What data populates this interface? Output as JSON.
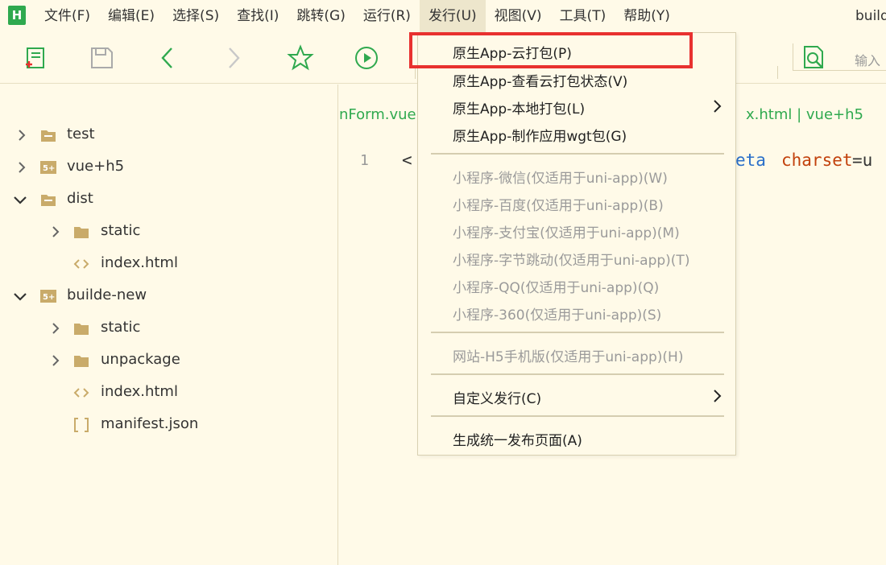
{
  "app": {
    "logo_letter": "H",
    "window_title": "builde"
  },
  "menubar": {
    "items": [
      {
        "label": "文件(F)"
      },
      {
        "label": "编辑(E)"
      },
      {
        "label": "选择(S)"
      },
      {
        "label": "查找(I)"
      },
      {
        "label": "跳转(G)"
      },
      {
        "label": "运行(R)"
      },
      {
        "label": "发行(U)"
      },
      {
        "label": "视图(V)"
      },
      {
        "label": "工具(T)"
      },
      {
        "label": "帮助(Y)"
      }
    ],
    "active_index": 6
  },
  "toolbar": {
    "search_placeholder": "输入"
  },
  "sidebar": {
    "items": [
      {
        "label": "test",
        "icon": "folder-icon"
      },
      {
        "label": "vue+h5",
        "icon": "uniapp-project-icon"
      },
      {
        "label": "dist",
        "icon": "folder-icon"
      },
      {
        "label": "static",
        "icon": "folder-icon"
      },
      {
        "label": "index.html",
        "icon": "html-file-icon"
      },
      {
        "label": "builde-new",
        "icon": "uniapp-project-icon"
      },
      {
        "label": "static",
        "icon": "folder-icon"
      },
      {
        "label": "unpackage",
        "icon": "folder-icon"
      },
      {
        "label": "index.html",
        "icon": "html-file-icon"
      },
      {
        "label": "manifest.json",
        "icon": "json-file-icon"
      }
    ]
  },
  "editor": {
    "tab_left": "nForm.vue",
    "tab_right": "x.html | vue+h5",
    "line_number": "1",
    "code_start": "<",
    "code_keyword": "eta",
    "code_attr": "charset",
    "code_rest": "=u"
  },
  "dropdown": {
    "items": [
      {
        "label": "原生App-云打包(P)",
        "enabled": true
      },
      {
        "label": "原生App-查看云打包状态(V)",
        "enabled": true
      },
      {
        "label": "原生App-本地打包(L)",
        "enabled": true,
        "submenu": true
      },
      {
        "label": "原生App-制作应用wgt包(G)",
        "enabled": true
      },
      {
        "label": "小程序-微信(仅适用于uni-app)(W)",
        "enabled": false
      },
      {
        "label": "小程序-百度(仅适用于uni-app)(B)",
        "enabled": false
      },
      {
        "label": "小程序-支付宝(仅适用于uni-app)(M)",
        "enabled": false
      },
      {
        "label": "小程序-字节跳动(仅适用于uni-app)(T)",
        "enabled": false
      },
      {
        "label": "小程序-QQ(仅适用于uni-app)(Q)",
        "enabled": false
      },
      {
        "label": "小程序-360(仅适用于uni-app)(S)",
        "enabled": false
      },
      {
        "label": "网站-H5手机版(仅适用于uni-app)(H)",
        "enabled": false
      },
      {
        "label": "自定义发行(C)",
        "enabled": true,
        "submenu": true
      },
      {
        "label": "生成统一发布页面(A)",
        "enabled": true
      }
    ]
  },
  "colors": {
    "background": "#fffae8",
    "accent_green": "#2fa94e",
    "highlight_red": "#e8312f",
    "folder_tan": "#c9ab6a",
    "disabled_text": "#9a9a9a"
  }
}
